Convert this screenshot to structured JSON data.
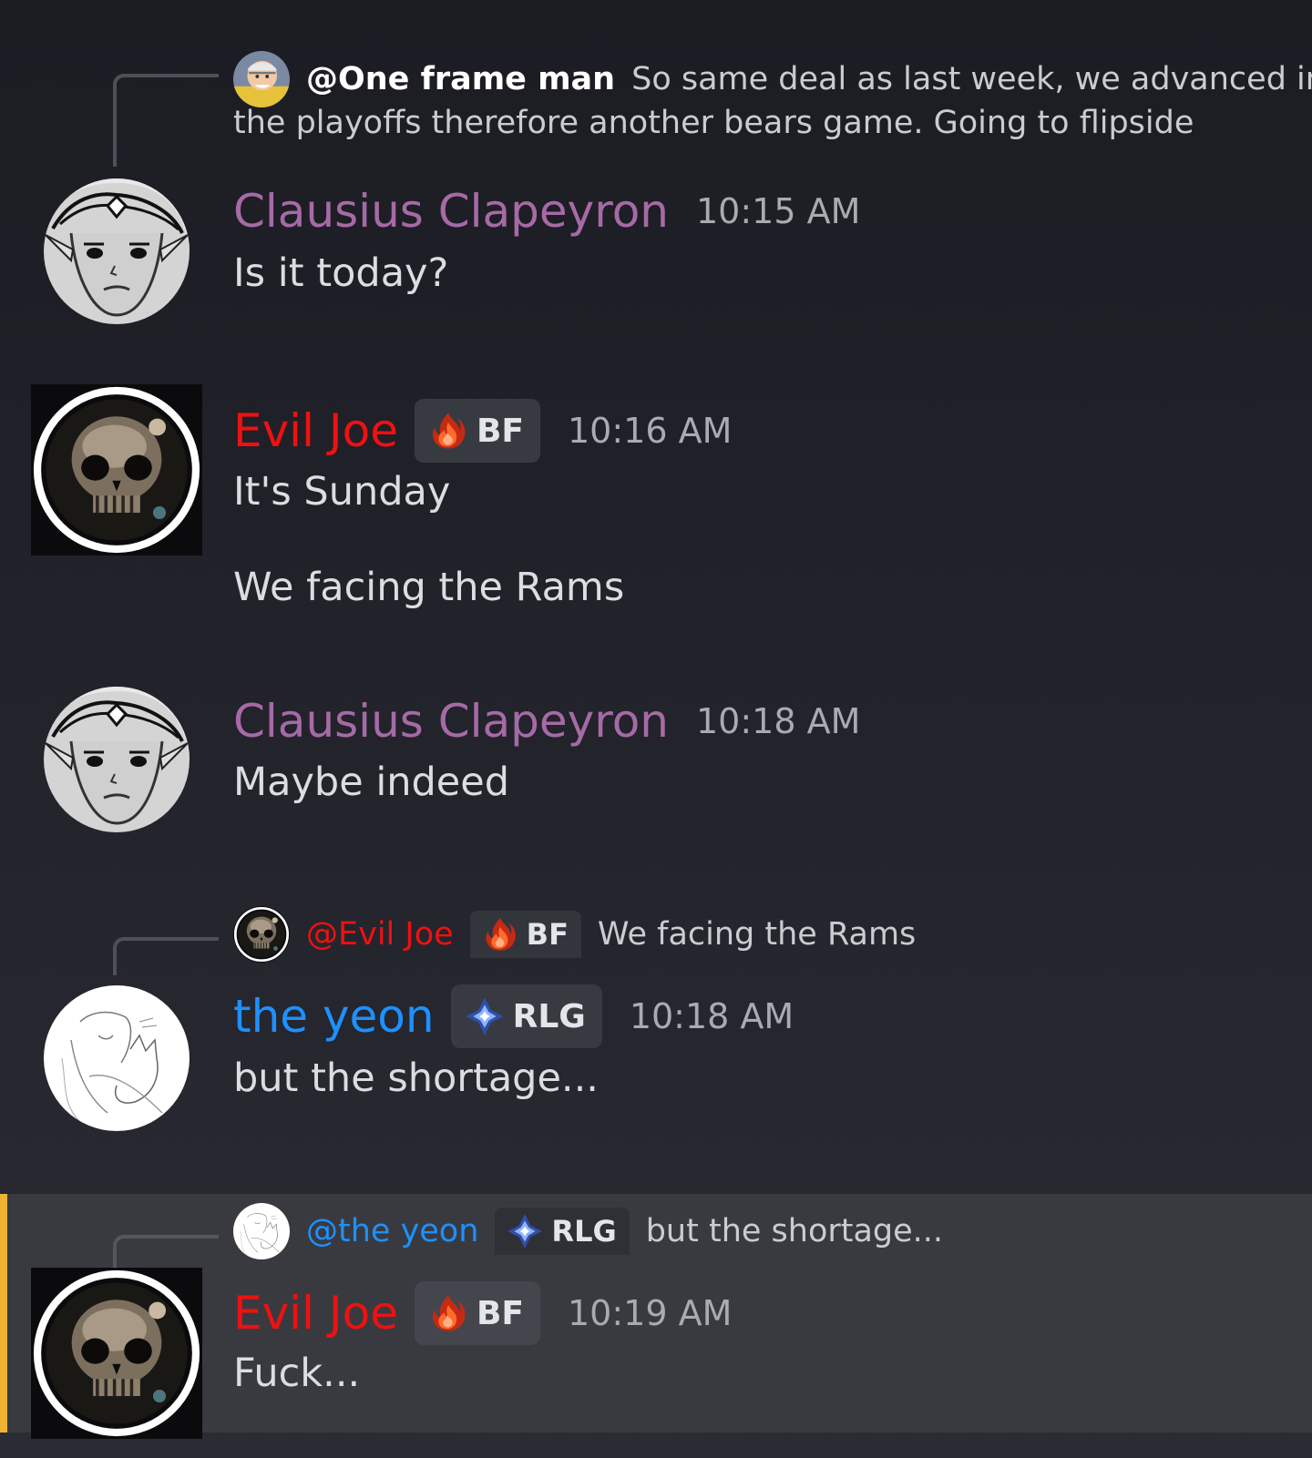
{
  "colors": {
    "clausius": "#a66aa6",
    "evil_joe": "#ee1111",
    "the_yeon": "#1e90ff",
    "mention_white": "#ffffff",
    "highlight_bar": "#f0b232"
  },
  "messages": [
    {
      "reply": {
        "author": "@One frame man",
        "text": "So same deal as last week, we advanced in",
        "text_line2": "the playoffs therefore another bears game. Going to flipside"
      },
      "author": "Clausius Clapeyron",
      "time": "10:15 AM",
      "lines": [
        "Is it today?"
      ]
    },
    {
      "author": "Evil Joe",
      "tag": {
        "icon": "fire-icon",
        "label": "BF"
      },
      "time": "10:16 AM",
      "lines": [
        "It's Sunday",
        "We facing the Rams"
      ]
    },
    {
      "author": "Clausius Clapeyron",
      "time": "10:18 AM",
      "lines": [
        "Maybe indeed"
      ]
    },
    {
      "reply": {
        "author": "@Evil Joe",
        "tag": {
          "icon": "fire-icon",
          "label": "BF"
        },
        "text": "We facing the Rams"
      },
      "author": "the yeon",
      "tag": {
        "icon": "diamond-icon",
        "label": "RLG"
      },
      "time": "10:18 AM",
      "lines": [
        "but the shortage..."
      ]
    },
    {
      "highlighted": true,
      "reply": {
        "author": "@the yeon",
        "tag": {
          "icon": "diamond-icon",
          "label": "RLG"
        },
        "text": "but the shortage..."
      },
      "author": "Evil Joe",
      "tag": {
        "icon": "fire-icon",
        "label": "BF"
      },
      "time": "10:19 AM",
      "lines": [
        "Fuck..."
      ]
    }
  ]
}
